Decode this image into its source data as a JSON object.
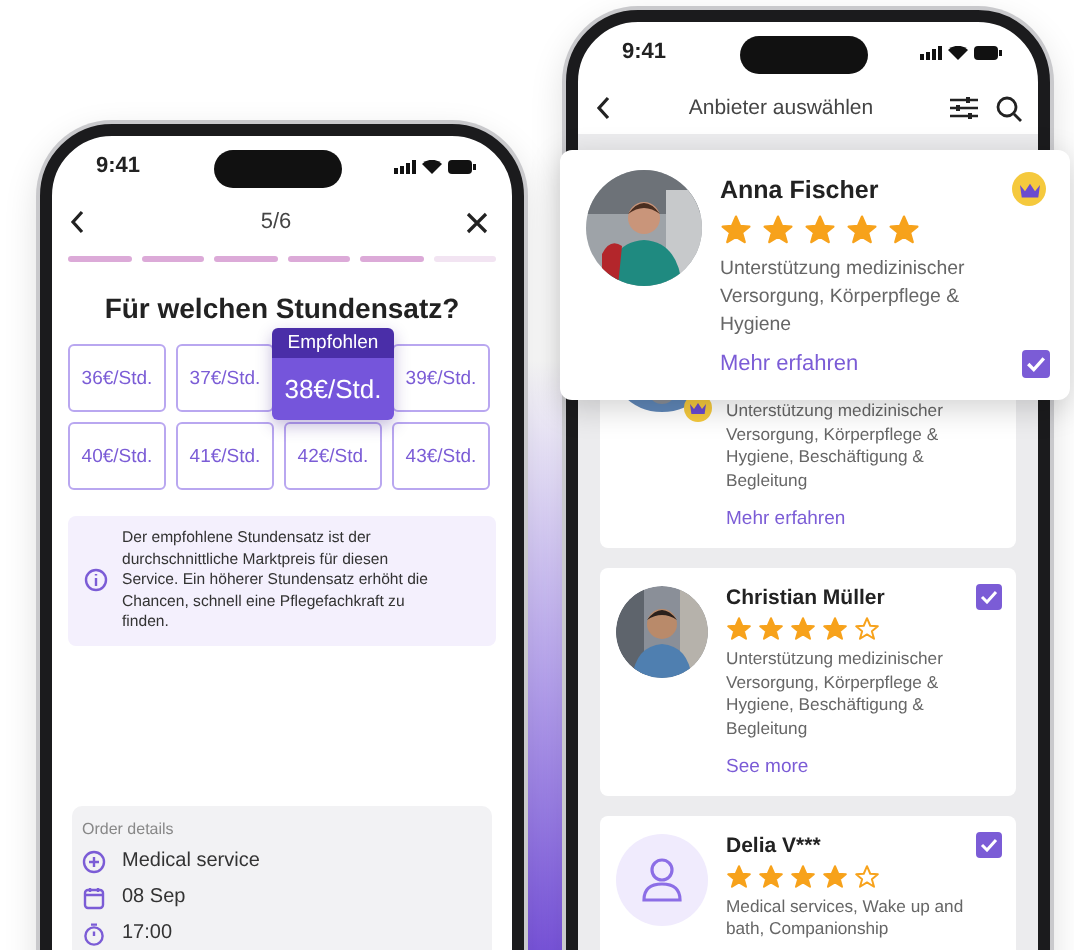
{
  "rate_screen": {
    "time": "9:41",
    "step": "5/6",
    "progress": [
      {
        "done": true
      },
      {
        "done": true
      },
      {
        "done": true
      },
      {
        "done": true
      },
      {
        "done": true
      },
      {
        "done": false
      }
    ],
    "title": "Für welchen Stundensatz?",
    "recommended_label": "Empfohlen",
    "rates": [
      {
        "label": "36€/Std.",
        "recommended": false
      },
      {
        "label": "37€/Std.",
        "recommended": false
      },
      {
        "label": "38€/Std.",
        "recommended": true
      },
      {
        "label": "39€/Std.",
        "recommended": false
      },
      {
        "label": "40€/Std.",
        "recommended": false
      },
      {
        "label": "41€/Std.",
        "recommended": false
      },
      {
        "label": "42€/Std.",
        "recommended": false
      },
      {
        "label": "43€/Std.",
        "recommended": false
      }
    ],
    "info": "Der empfohlene Stundensatz ist der durchschnittliche Marktpreis für diesen Service. Ein höherer Stundensatz erhöht die Chancen, schnell eine Pflegefachkraft zu finden.",
    "order_details": {
      "title": "Order details",
      "items": [
        {
          "kind": "service",
          "text": "Medical service"
        },
        {
          "kind": "date",
          "text": "08 Sep"
        },
        {
          "kind": "time",
          "text": "17:00"
        }
      ]
    }
  },
  "provider_screen": {
    "time": "9:41",
    "title": "Anbieter auswählen",
    "featured": {
      "name": "Anna Fischer",
      "stars": 5,
      "premium": true,
      "description": "Unterstützung medizinischer Versorgung, Körperpflege & Hygiene",
      "link": "Mehr erfahren",
      "selected": true
    },
    "providers": [
      {
        "premium": true,
        "description": "Unterstützung medizinischer Versorgung, Körperpflege & Hygiene, Beschäftigung & Begleitung",
        "link": "Mehr erfahren"
      },
      {
        "name": "Christian Müller",
        "stars": 4,
        "premium": false,
        "description": "Unterstützung medizinischer Versorgung, Körperpflege & Hygiene, Beschäftigung & Begleitung",
        "link": "See more",
        "selected": true
      },
      {
        "kind": "placeholder",
        "name": "Delia V***",
        "stars": 4,
        "premium": false,
        "description": "Medical services, Wake up and bath, Companionship",
        "selected": true
      }
    ]
  }
}
